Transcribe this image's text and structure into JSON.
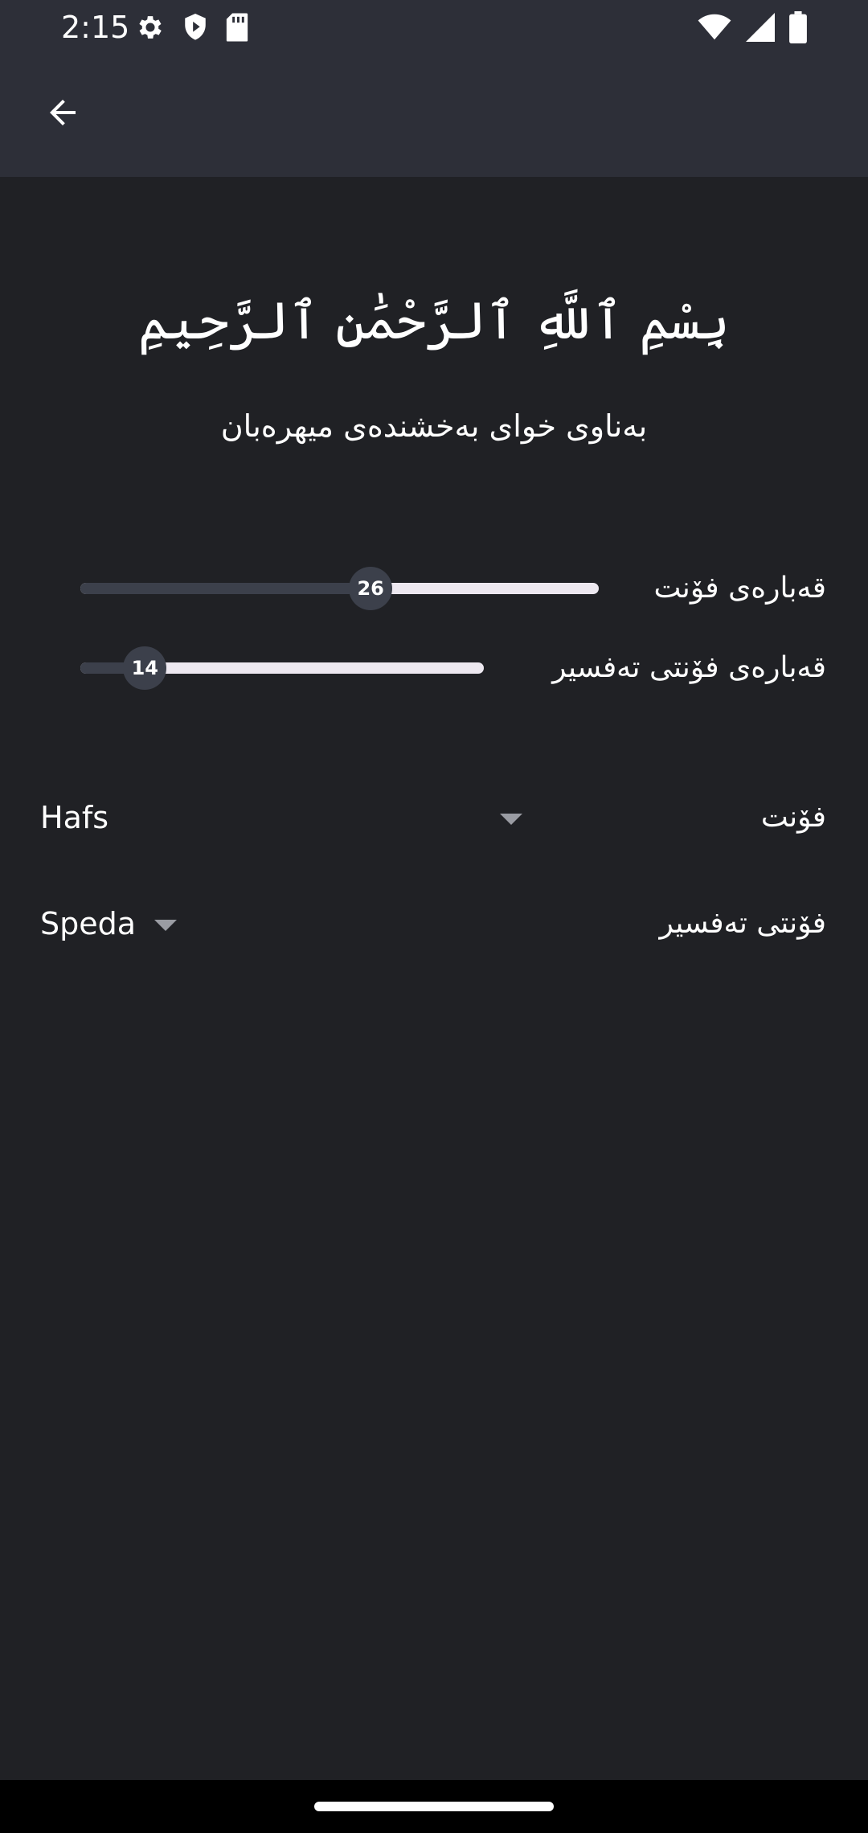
{
  "status_bar": {
    "time": "2:15",
    "left_icons": [
      "settings-gear-icon",
      "shield-icon",
      "sd-card-icon"
    ],
    "right_icons": [
      "wifi-icon",
      "cell-signal-icon",
      "battery-icon"
    ]
  },
  "app_bar": {
    "back_icon": "arrow-back-icon"
  },
  "preview": {
    "arabic_text": "بِسْمِ ٱللَّهِ ٱلرَّحْمَٰنِ ٱلرَّحِيمِ",
    "translation": "بەناوی خوای بەخشندەی میهرەبان"
  },
  "settings": {
    "font_size": {
      "label": "قەبارەی فۆنت",
      "value": "26",
      "fraction": 0.56
    },
    "tafsir_font_size": {
      "label": "قەبارەی فۆنتی تەفسیر",
      "value": "14",
      "fraction": 0.16
    },
    "font": {
      "label": "فۆنت",
      "selected": "Hafs"
    },
    "tafsir_font": {
      "label": "فۆنتی تەفسیر",
      "selected": "Speda"
    }
  },
  "colors": {
    "background": "#202125",
    "app_bar": "#2d2f38",
    "slider_active": "#3c404b",
    "slider_inactive": "#ede8f0",
    "text": "#ffffff"
  }
}
